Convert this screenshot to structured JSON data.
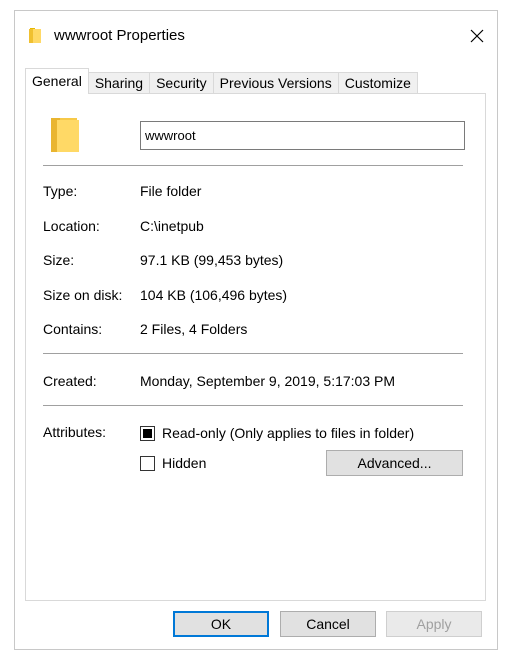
{
  "window": {
    "title": "wwwroot Properties",
    "folder_icon_color": "#ffd966"
  },
  "tabs": [
    {
      "label": "General",
      "active": true
    },
    {
      "label": "Sharing",
      "active": false
    },
    {
      "label": "Security",
      "active": false
    },
    {
      "label": "Previous Versions",
      "active": false
    },
    {
      "label": "Customize",
      "active": false
    }
  ],
  "general": {
    "name_value": "wwwroot",
    "type_label": "Type:",
    "type_value": "File folder",
    "location_label": "Location:",
    "location_value": "C:\\inetpub",
    "size_label": "Size:",
    "size_value": "97.1 KB (99,453 bytes)",
    "size_on_disk_label": "Size on disk:",
    "size_on_disk_value": "104 KB (106,496 bytes)",
    "contains_label": "Contains:",
    "contains_value": "2 Files, 4 Folders",
    "created_label": "Created:",
    "created_value": "Monday, September 9, 2019, 5:17:03 PM",
    "attributes_label": "Attributes:",
    "readonly_label": "Read-only (Only applies to files in folder)",
    "readonly_state": "indeterminate",
    "hidden_label": "Hidden",
    "hidden_state": "unchecked",
    "advanced_label": "Advanced..."
  },
  "footer": {
    "ok_label": "OK",
    "cancel_label": "Cancel",
    "apply_label": "Apply"
  }
}
